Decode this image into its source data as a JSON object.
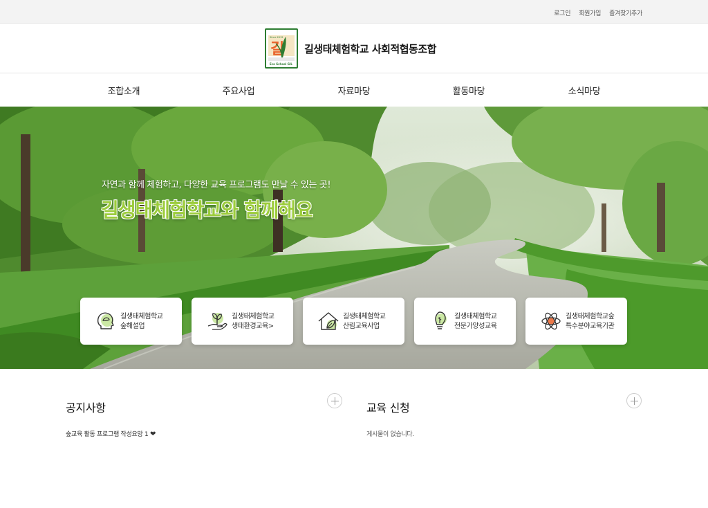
{
  "topbar": {
    "login": "로그인",
    "signup": "회원가입",
    "bookmark": "즐겨찾기추가"
  },
  "header": {
    "title": "길생태체험학교 사회적협동조합",
    "logo": {
      "char": "길",
      "tagline": "Eco School GIL",
      "since": "Since 2015"
    }
  },
  "nav": [
    {
      "label": "조합소개"
    },
    {
      "label": "주요사업"
    },
    {
      "label": "자료마당"
    },
    {
      "label": "활동마당"
    },
    {
      "label": "소식마당"
    }
  ],
  "hero": {
    "subtitle": "자연과 함께 체험하고, 다양한 교육 프로그램도 만날 수 있는 곳!",
    "headline": "길생태체험학교와 함께해요"
  },
  "cards": [
    {
      "line1": "길생태체험학교",
      "line2": "숲해설업",
      "icon": "head-leaf-icon"
    },
    {
      "line1": "길생태체험학교",
      "line2": "생태환경교육>",
      "icon": "hand-sprout-icon"
    },
    {
      "line1": "길생태체험학교",
      "line2": "산림교육사업",
      "icon": "house-leaf-icon"
    },
    {
      "line1": "길생태체험학교",
      "line2": "전문가양성교육",
      "icon": "lightbulb-icon"
    },
    {
      "line1": "길생태체험학교숲",
      "line2": "특수분야교육기관",
      "icon": "atom-icon"
    }
  ],
  "notice": {
    "title": "공지사항",
    "posts": [
      {
        "text": "숲교육 활동 프로그램 작성요망 1"
      }
    ]
  },
  "education": {
    "title": "교육 신청",
    "empty": "게시물이 없습니다."
  },
  "colors": {
    "brand_green": "#2e7d32",
    "headline_green": "#9ccc3c",
    "accent_orange": "#e8622a"
  }
}
